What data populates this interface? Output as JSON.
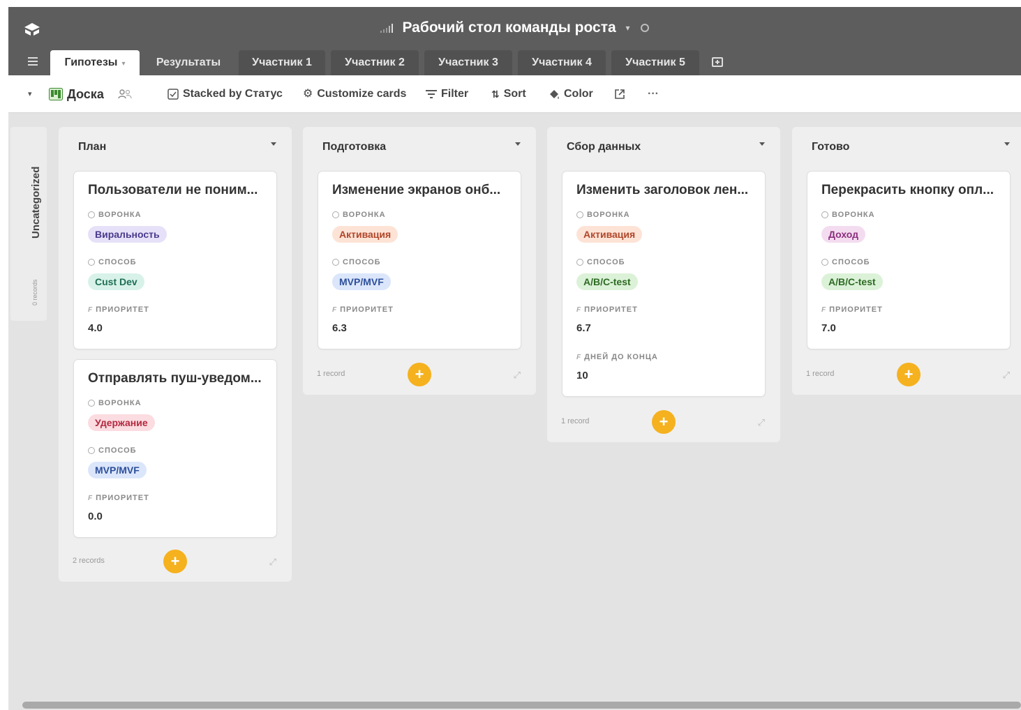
{
  "header": {
    "title": "Рабочий стол команды роста"
  },
  "tabs": [
    {
      "label": "Гипотезы",
      "active": true
    },
    {
      "label": "Результаты"
    },
    {
      "label": "Участник 1"
    },
    {
      "label": "Участник 2"
    },
    {
      "label": "Участник 3"
    },
    {
      "label": "Участник 4"
    },
    {
      "label": "Участник 5"
    }
  ],
  "toolbar": {
    "view_name": "Доска",
    "stacked": "Stacked by Статус",
    "customize": "Customize cards",
    "filter": "Filter",
    "sort": "Sort",
    "color": "Color",
    "more": "···"
  },
  "uncategorized": {
    "label": "Uncategorized",
    "count": "0 records"
  },
  "fields": {
    "funnel": "ВОРОНКА",
    "method": "СПОСОБ",
    "priority": "ПРИОРИТЕТ",
    "days_left": "ДНЕЙ ДО КОНЦА"
  },
  "colors": {
    "Виральность": {
      "bg": "#e6e1f8",
      "fg": "#4b3a8c"
    },
    "Активация": {
      "bg": "#fde3d6",
      "fg": "#b0462a"
    },
    "Доход": {
      "bg": "#f4dcf0",
      "fg": "#8a2f7d"
    },
    "Удержание": {
      "bg": "#fbdce0",
      "fg": "#b3283e"
    },
    "Cust Dev": {
      "bg": "#d8f2ea",
      "fg": "#1f6f55"
    },
    "MVP/MVF": {
      "bg": "#dbe6fb",
      "fg": "#2d4f9a"
    },
    "A/B/C-test": {
      "bg": "#dcf2d8",
      "fg": "#2e6b24"
    },
    "accent": "#f5b11e"
  },
  "columns": [
    {
      "title": "План",
      "records": "2 records",
      "cards": [
        {
          "title": "Пользователи не поним...",
          "funnel": "Виральность",
          "method": "Cust Dev",
          "priority": "4.0"
        },
        {
          "title": "Отправлять пуш-уведом...",
          "funnel": "Удержание",
          "method": "MVP/MVF",
          "priority": "0.0"
        }
      ]
    },
    {
      "title": "Подготовка",
      "records": "1 record",
      "cards": [
        {
          "title": "Изменение экранов онб...",
          "funnel": "Активация",
          "method": "MVP/MVF",
          "priority": "6.3"
        }
      ]
    },
    {
      "title": "Сбор данных",
      "records": "1 record",
      "cards": [
        {
          "title": "Изменить заголовок лен...",
          "funnel": "Активация",
          "method": "A/B/C-test",
          "priority": "6.7",
          "days_left": "10"
        }
      ]
    },
    {
      "title": "Готово",
      "records": "1 record",
      "cards": [
        {
          "title": "Перекрасить кнопку опл...",
          "funnel": "Доход",
          "method": "A/B/C-test",
          "priority": "7.0"
        }
      ]
    }
  ]
}
